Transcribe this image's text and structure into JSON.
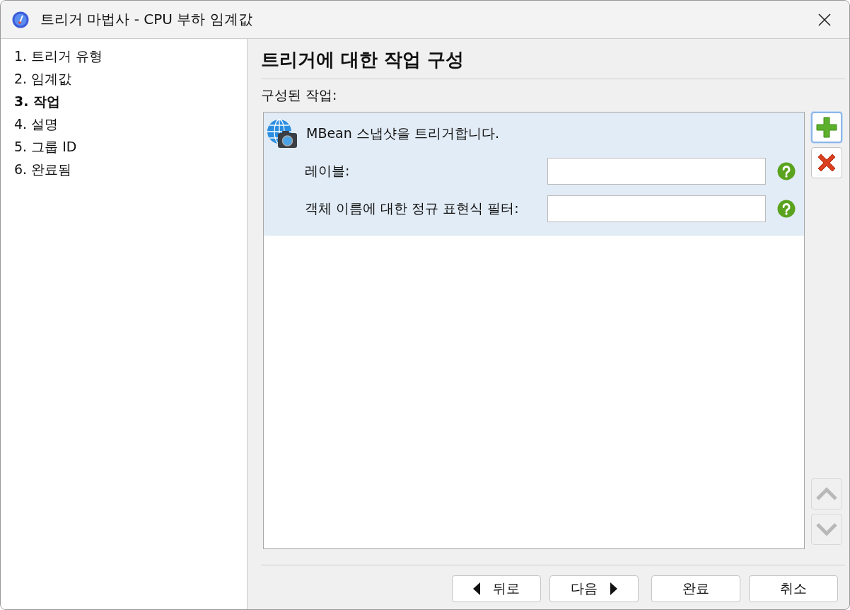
{
  "window": {
    "title": "트리거 마법사 - CPU 부하 임계값"
  },
  "steps": [
    {
      "label": "1. 트리거 유형",
      "selected": false
    },
    {
      "label": "2. 임계값",
      "selected": false
    },
    {
      "label": "3. 작업",
      "selected": true
    },
    {
      "label": "4. 설명",
      "selected": false
    },
    {
      "label": "5. 그룹 ID",
      "selected": false
    },
    {
      "label": "6. 완료됨",
      "selected": false
    }
  ],
  "heading": "트리거에 대한 작업 구성",
  "actions_label": "구성된 작업:",
  "actions": [
    {
      "title": "MBean 스냅샷을 트리거합니다.",
      "selected": true,
      "fields": [
        {
          "label": "레이블:"
        },
        {
          "label": "객체 이름에 대한 정규 표현식 필터:"
        }
      ]
    }
  ],
  "side_buttons": [
    {
      "kind": "add",
      "disabled": false,
      "focused": true
    },
    {
      "kind": "remove",
      "disabled": false,
      "focused": false
    },
    {
      "kind": "up",
      "disabled": true,
      "focused": false
    },
    {
      "kind": "down",
      "disabled": true,
      "focused": false
    }
  ],
  "footer_buttons": [
    {
      "label": "뒤로",
      "kind": "back"
    },
    {
      "label": "다음",
      "kind": "next"
    },
    {
      "label": "완료",
      "kind": "plain"
    },
    {
      "label": "취소",
      "kind": "plain"
    }
  ]
}
